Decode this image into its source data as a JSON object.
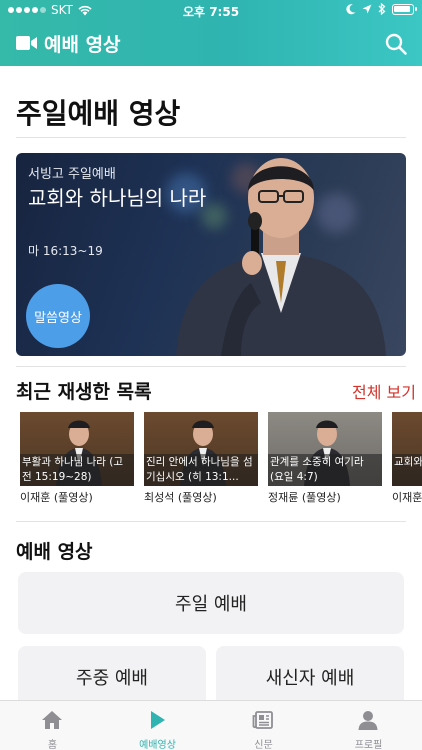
{
  "status_bar": {
    "carrier": "SKT",
    "time": "오후 7:55"
  },
  "app_bar": {
    "title": "예배 영상",
    "title_icon": "video-camera-icon",
    "search_icon": "search-icon"
  },
  "page": {
    "title": "주일예배 영상"
  },
  "featured": {
    "subtitle": "서빙고 주일예배",
    "title": "교회와 하나님의 나라",
    "verse": "마 16:13~19",
    "badge": "말씀영상"
  },
  "recent": {
    "title": "최근 재생한 목록",
    "see_all": "전체 보기",
    "items": [
      {
        "caption": "부활과 하나님 나라 (고전 15:19~28)",
        "speaker": "이재훈 (풀영상)"
      },
      {
        "caption": "진리 안에서 하나님을 섬기십시오 (히 13:1...",
        "speaker": "최성석 (풀영상)"
      },
      {
        "caption": "관계를 소중히 여기라 (요일 4:7)",
        "speaker": "정재륜 (풀영상)"
      },
      {
        "caption": "교회와 (마 16:1",
        "speaker": "이재훈"
      }
    ]
  },
  "worship": {
    "title": "예배 영상",
    "sunday": "주일 예배",
    "midweek": "주중 예배",
    "newcomer": "새신자 예배"
  },
  "tabbar": {
    "home": "홈",
    "worship_video": "예배영상",
    "newspaper": "신문",
    "profile": "프로필"
  },
  "colors": {
    "accent": "#2fb4b1",
    "see_all": "#d3332b",
    "badge": "#4d9ee8"
  }
}
